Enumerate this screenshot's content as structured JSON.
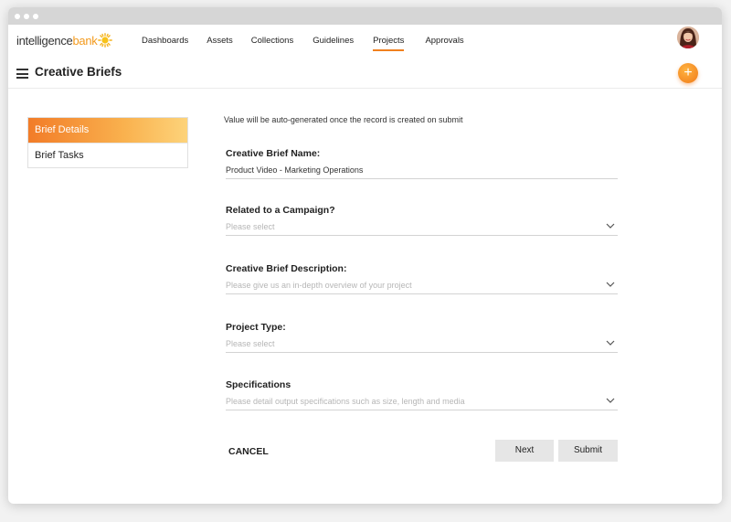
{
  "brand": {
    "name_part1": "intelligence",
    "name_part2": "bank"
  },
  "nav": {
    "items": [
      "Dashboards",
      "Assets",
      "Collections",
      "Guidelines",
      "Projects",
      "Approvals"
    ],
    "active": "Projects"
  },
  "header": {
    "title": "Creative Briefs",
    "add_symbol": "+"
  },
  "side_tabs": [
    {
      "label": "Brief Details",
      "active": true
    },
    {
      "label": "Brief Tasks",
      "active": false
    }
  ],
  "form": {
    "autogen_note": "Value will be auto-generated once the record is created on submit",
    "fields": [
      {
        "label": "Creative Brief Name:",
        "value": "Product Video - Marketing Operations",
        "placeholder": ""
      },
      {
        "label": "Related to a Campaign?",
        "value": "",
        "placeholder": "Please select"
      },
      {
        "label": "Creative Brief Description:",
        "value": "",
        "placeholder": "Please give us an in-depth overview of your project"
      },
      {
        "label": "Project Type:",
        "value": "",
        "placeholder": "Please select"
      },
      {
        "label": "Specifications",
        "value": "",
        "placeholder": "Please detail output specifications such as size, length and media"
      }
    ]
  },
  "actions": {
    "cancel": "CANCEL",
    "next": "Next",
    "submit": "Submit"
  },
  "colors": {
    "accent": "#f0801e",
    "accent_light": "#fdd37a"
  }
}
